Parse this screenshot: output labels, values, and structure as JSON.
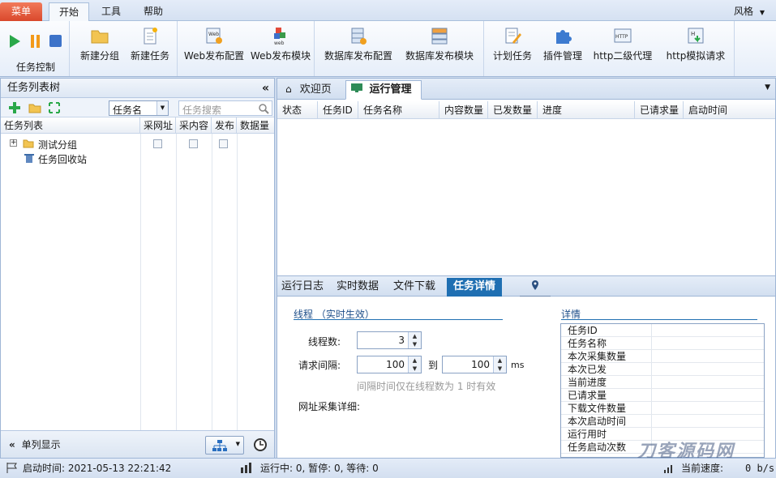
{
  "menubar": {
    "menu_label": "菜单",
    "tabs": [
      "开始",
      "工具",
      "帮助"
    ],
    "style_label": "风格"
  },
  "ribbon": {
    "task_control_label": "任务控制",
    "buttons": [
      "新建分组",
      "新建任务",
      "Web发布配置",
      "Web发布模块",
      "数据库发布配置",
      "数据库发布模块",
      "计划任务",
      "插件管理",
      "http二级代理",
      "http模拟请求"
    ]
  },
  "left_panel": {
    "title": "任务列表树",
    "collapse_glyph": "«",
    "filter_select": "任务名",
    "search_placeholder": "任务搜索",
    "columns": [
      "任务列表",
      "采网址",
      "采内容",
      "发布",
      "数据量"
    ],
    "tree": [
      {
        "label": "测试分组"
      },
      {
        "label": "任务回收站"
      }
    ],
    "single_column_label": "单列显示"
  },
  "right_panel": {
    "tabs": [
      "欢迎页",
      "运行管理"
    ],
    "columns": [
      "状态",
      "任务ID",
      "任务名称",
      "内容数量",
      "已发数量",
      "进度",
      "已请求量",
      "启动时间"
    ],
    "bottom_tabs": [
      "运行日志",
      "实时数据",
      "文件下载",
      "任务详情"
    ],
    "thread_section": {
      "title": "线程 （实时生效）",
      "thread_count_label": "线程数:",
      "thread_count": "3",
      "interval_label": "请求间隔:",
      "interval_from": "100",
      "to_label": "到",
      "interval_to": "100",
      "unit": "ms",
      "hint": "间隔时间仅在线程数为 1 时有效",
      "url_detail_label": "网址采集详细:"
    },
    "details": {
      "title": "详情",
      "rows": [
        "任务ID",
        "任务名称",
        "本次采集数量",
        "本次已发",
        "当前进度",
        "已请求量",
        "下载文件数量",
        "本次启动时间",
        "运行用时",
        "任务启动次数"
      ]
    }
  },
  "status_bar": {
    "start_time": "启动时间: 2021-05-13 22:21:42",
    "running": "运行中: 0,  暂停: 0,  等待: 0",
    "speed_label": "当前速度:",
    "speed_value": "0 b/s"
  },
  "watermark": "刀客源码网",
  "colors": {
    "accent": "#1f6fb2",
    "menu_orange": "#e25a3a",
    "selected_tab": "#1f6fb2"
  }
}
